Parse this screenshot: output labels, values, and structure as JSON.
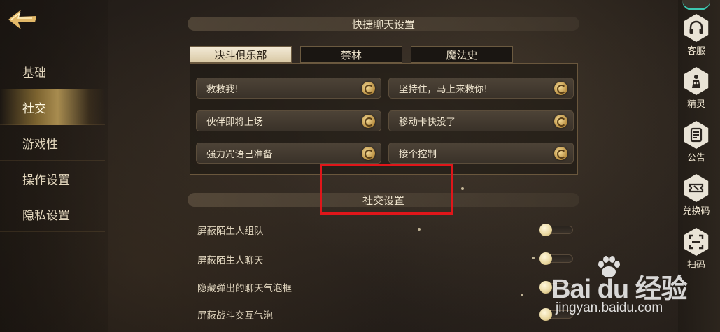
{
  "nav": {
    "items": [
      {
        "label": "基础"
      },
      {
        "label": "社交"
      },
      {
        "label": "游戏性"
      },
      {
        "label": "操作设置"
      },
      {
        "label": "隐私设置"
      }
    ],
    "active_index": 1
  },
  "quick_chat": {
    "title": "快捷聊天设置",
    "tabs": [
      {
        "label": "决斗俱乐部"
      },
      {
        "label": "禁林"
      },
      {
        "label": "魔法史"
      }
    ],
    "messages": [
      {
        "label": "救救我!"
      },
      {
        "label": "坚持住，马上来救你!"
      },
      {
        "label": "伙伴即将上场"
      },
      {
        "label": "移动卡快没了"
      },
      {
        "label": "强力咒语已准备"
      },
      {
        "label": "接个控制"
      }
    ]
  },
  "social": {
    "title": "社交设置",
    "settings": [
      {
        "label": "屏蔽陌生人组队",
        "enabled": false
      },
      {
        "label": "屏蔽陌生人聊天",
        "enabled": false
      },
      {
        "label": "隐藏弹出的聊天气泡框",
        "enabled": false
      },
      {
        "label": "屏蔽战斗交互气泡",
        "enabled": false
      }
    ]
  },
  "rail": {
    "items": [
      {
        "label": "客服",
        "icon": "headset-icon"
      },
      {
        "label": "精灵",
        "icon": "sprite-icon"
      },
      {
        "label": "公告",
        "icon": "scroll-icon"
      },
      {
        "label": "兑换码",
        "icon": "ticket-icon"
      },
      {
        "label": "扫码",
        "icon": "scan-icon"
      }
    ]
  },
  "watermark": {
    "brand": "Bai du 经验",
    "url": "jingyan.baidu.com"
  },
  "colors": {
    "highlight": "#e0161a",
    "accent_gold": "#c9a35a",
    "rail_accent": "#3cc7b0"
  }
}
